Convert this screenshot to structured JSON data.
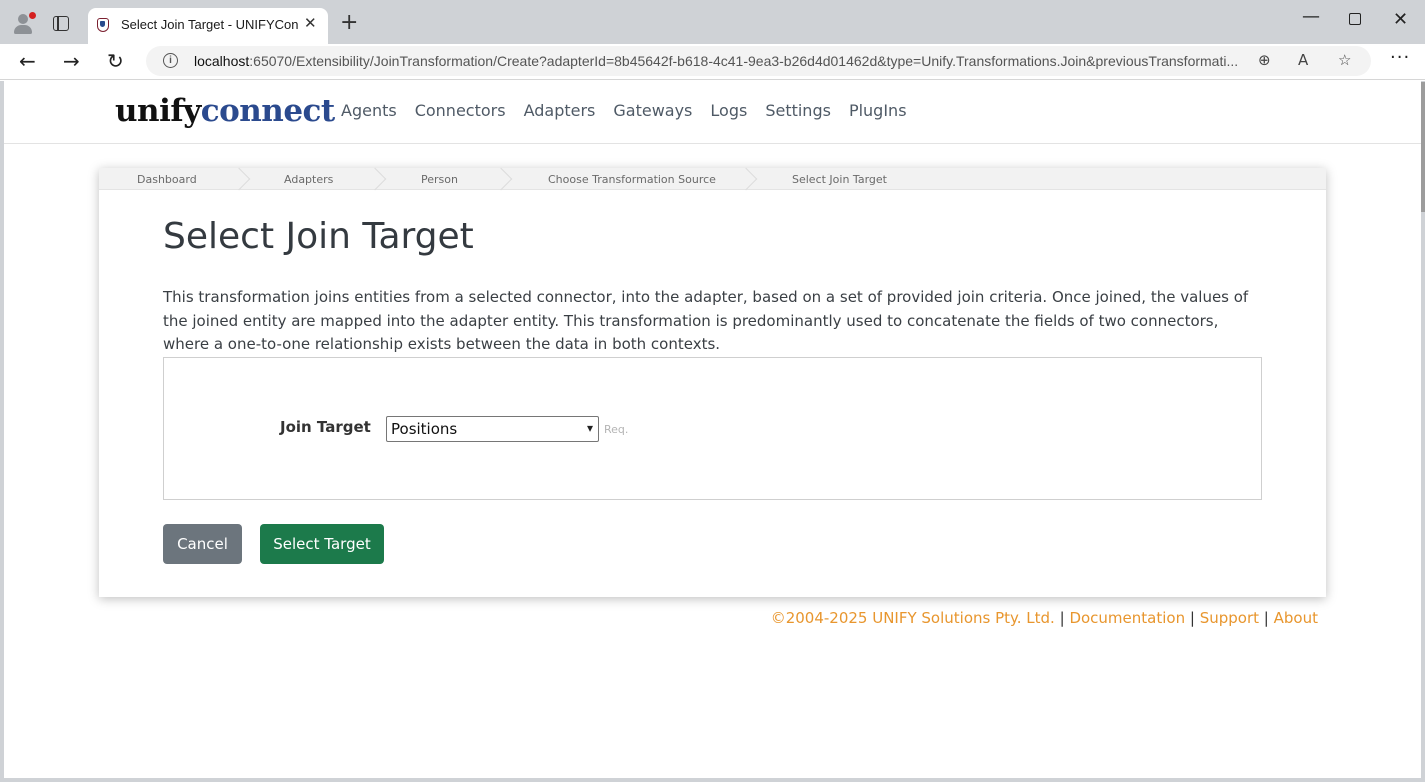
{
  "browser": {
    "tab_title": "Select Join Target - UNIFYConnect",
    "url_host": "localhost",
    "url_rest": ":65070/Extensibility/JoinTransformation/Create?adapterId=8b45642f-b618-4c41-9ea3-b26d4d01462d&type=Unify.Transformations.Join&previousTransformati..."
  },
  "header": {
    "logo_part1": "unify",
    "logo_part2": "connect",
    "nav": [
      "Agents",
      "Connectors",
      "Adapters",
      "Gateways",
      "Logs",
      "Settings",
      "PlugIns"
    ]
  },
  "breadcrumb": [
    "Dashboard",
    "Adapters",
    "Person",
    "Choose Transformation Source",
    "Select Join Target"
  ],
  "main": {
    "title": "Select Join Target",
    "description": "This transformation joins entities from a selected connector, into the adapter, based on a set of provided join criteria. Once joined, the values of the joined entity are mapped into the adapter entity. This transformation is predominantly used to concatenate the fields of two connectors, where a one-to-one relationship exists between the data in both contexts.",
    "join_target_label": "Join Target",
    "join_target_value": "Positions",
    "required_hint": "Req.",
    "cancel_label": "Cancel",
    "select_label": "Select Target"
  },
  "footer": {
    "copyright": "©2004-2025 UNIFY Solutions Pty. Ltd.",
    "sep": "|",
    "links": [
      "Documentation",
      "Support",
      "About"
    ]
  },
  "colors": {
    "logo_accent": "#2b4a8e",
    "cancel_button": "#6c757d",
    "primary_button": "#1c7a4b",
    "footer_link": "#e8962e"
  }
}
